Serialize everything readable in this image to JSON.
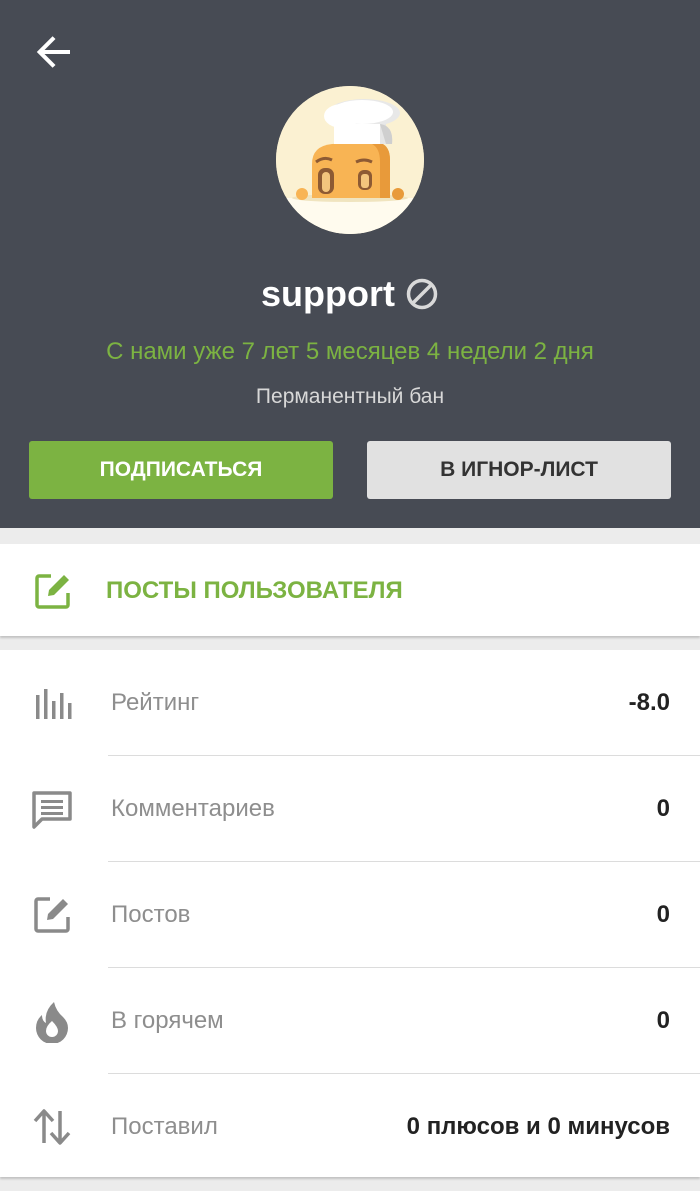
{
  "header": {
    "back_icon": "arrow-back-icon",
    "username": "support",
    "ban_icon": "ban-icon",
    "member_since": "С нами уже 7 лет 5 месяцев 4 недели 2 дня",
    "ban_status": "Перманентный бан",
    "subscribe_label": "ПОДПИСАТЬСЯ",
    "ignore_label": "В ИГНОР-ЛИСТ"
  },
  "posts_link": {
    "icon": "edit-icon",
    "label": "ПОСТЫ ПОЛЬЗОВАТЕЛЯ"
  },
  "stats": [
    {
      "icon": "bar-chart-icon",
      "label": "Рейтинг",
      "value": "-8.0"
    },
    {
      "icon": "comment-icon",
      "label": "Комментариев",
      "value": "0"
    },
    {
      "icon": "edit-icon",
      "label": "Постов",
      "value": "0"
    },
    {
      "icon": "fire-icon",
      "label": "В горячем",
      "value": "0"
    },
    {
      "icon": "swap-vertical-icon",
      "label": "Поставил",
      "value": "0 плюсов и 0 минусов"
    }
  ],
  "colors": {
    "header_bg": "#474b54",
    "accent_green": "#7cb342",
    "ignore_button_bg": "#e1e1e1",
    "icon_gray": "#8a8a8a"
  }
}
